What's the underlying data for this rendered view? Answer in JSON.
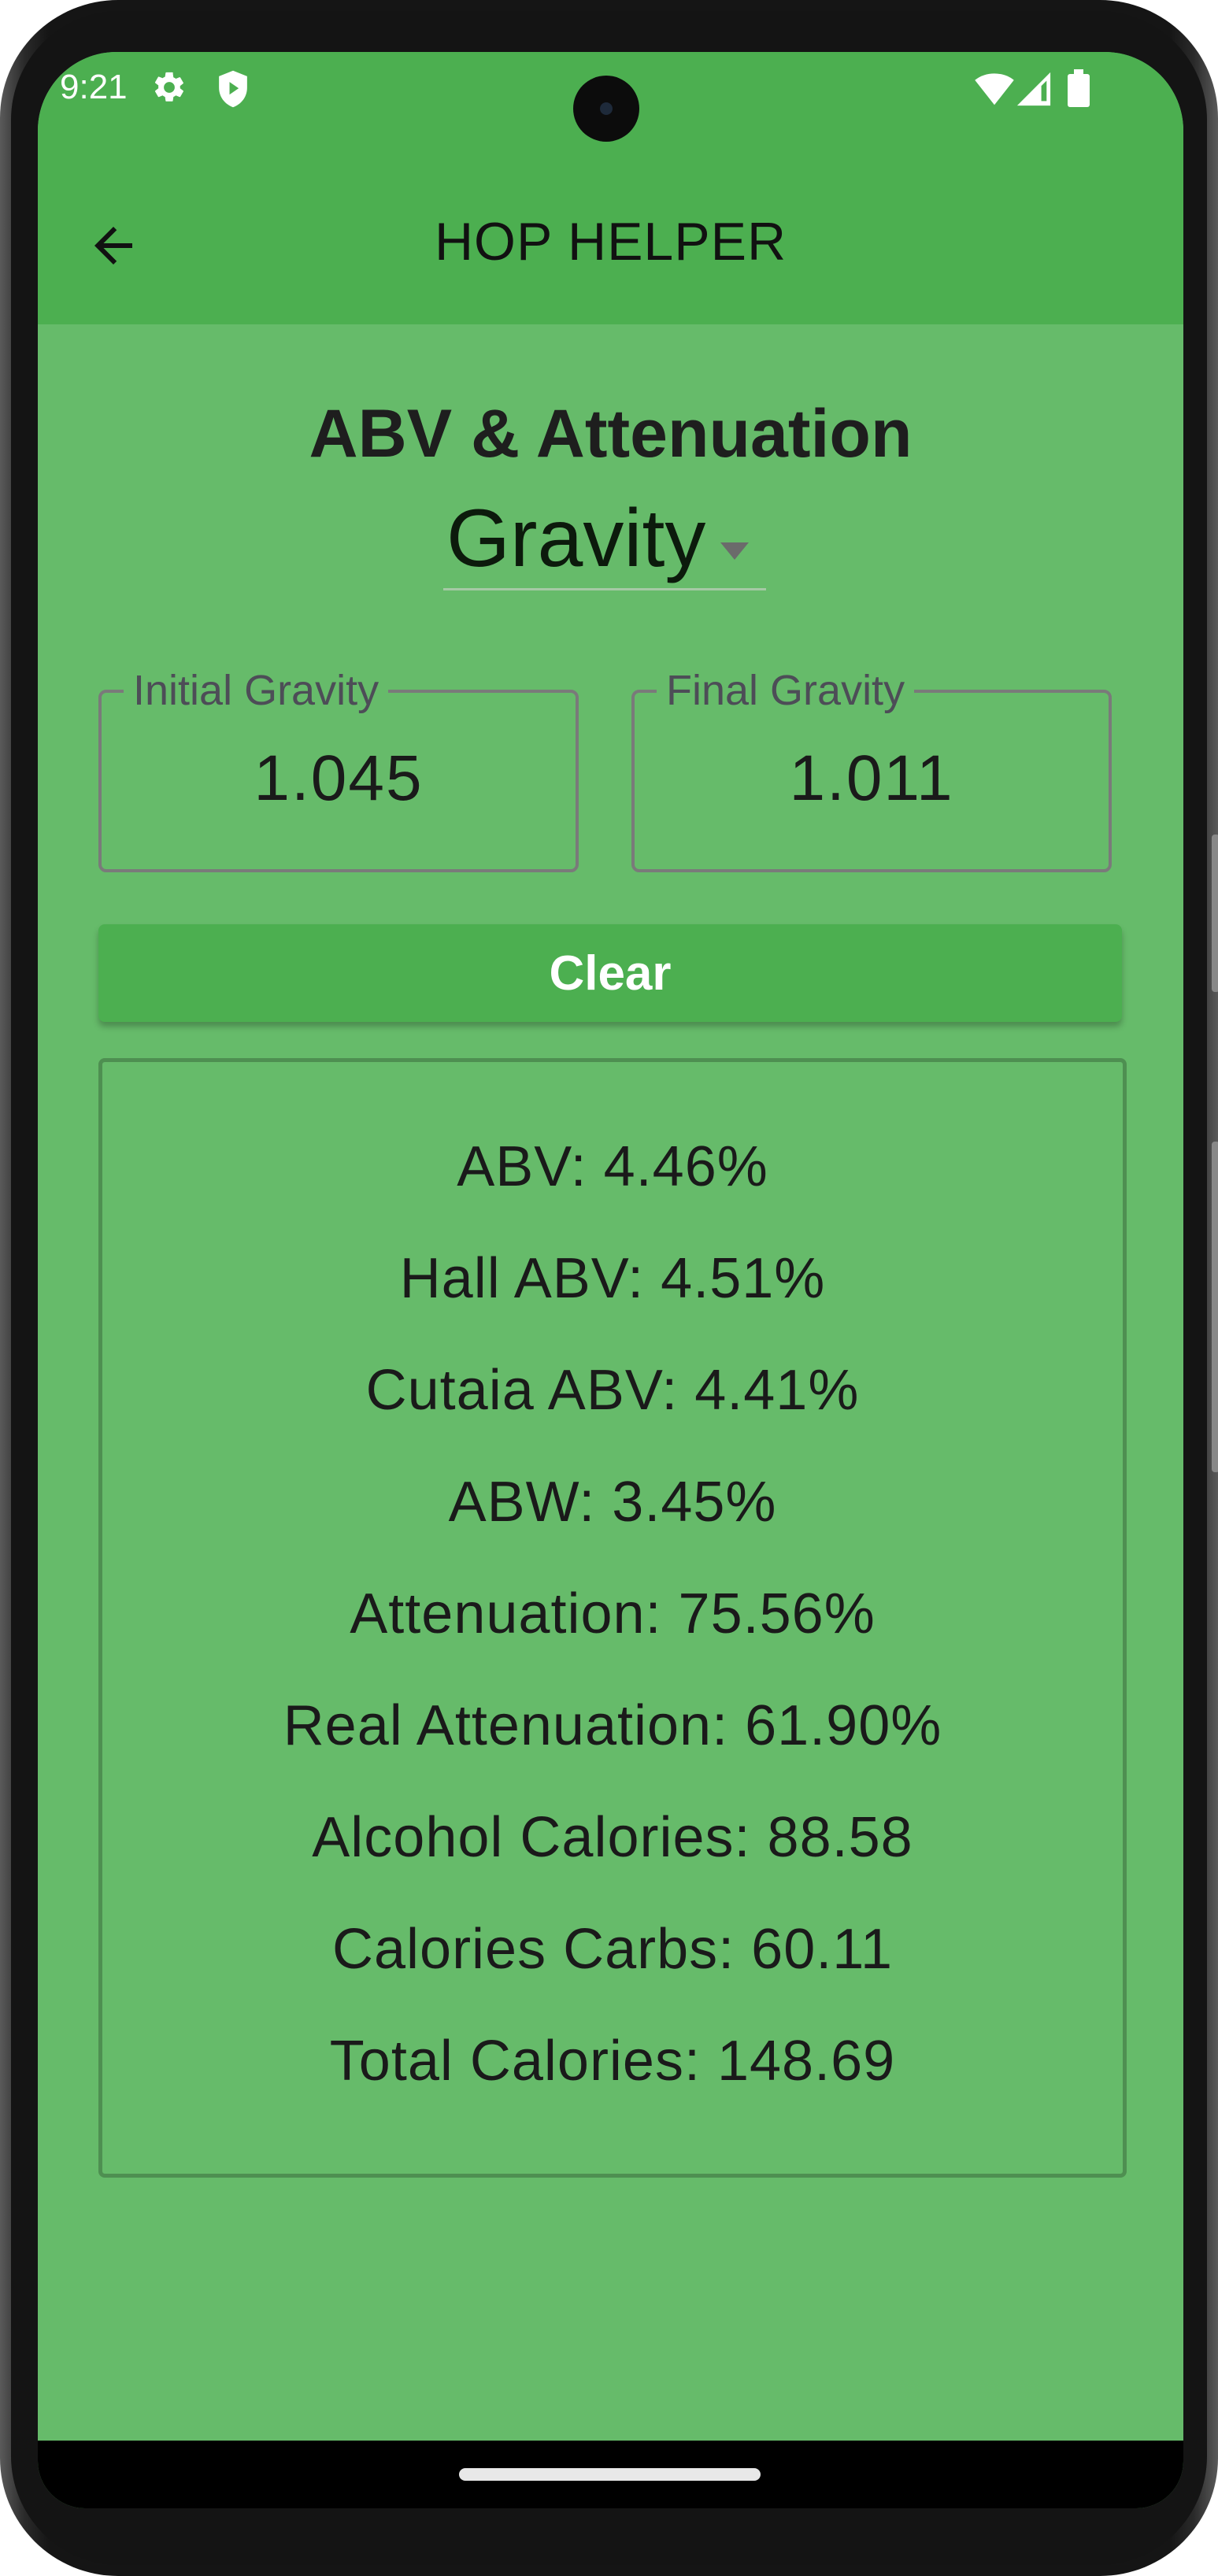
{
  "status_bar": {
    "time": "9:21",
    "left_icons": [
      "gear-icon",
      "shield-play-icon"
    ],
    "right_icons": [
      "wifi-icon",
      "cellular-signal-icon",
      "battery-icon"
    ]
  },
  "app_bar": {
    "title": "HOP HELPER",
    "back_icon": "arrow-left-icon"
  },
  "page": {
    "title": "ABV & Attenuation",
    "mode_dropdown": {
      "selected": "Gravity"
    },
    "inputs": {
      "initial": {
        "label": "Initial Gravity",
        "value": "1.045"
      },
      "final": {
        "label": "Final Gravity",
        "value": "1.011"
      }
    },
    "clear_label": "Clear",
    "results": [
      "ABV: 4.46%",
      "Hall ABV: 4.51%",
      "Cutaia ABV: 4.41%",
      "ABW: 3.45%",
      "Attenuation: 75.56%",
      "Real Attenuation: 61.90%",
      "Alcohol Calories: 88.58",
      "Calories Carbs: 60.11",
      "Total Calories: 148.69"
    ]
  },
  "colors": {
    "primary": "#4caf50",
    "background": "#66bb6a",
    "results_border": "#4e8f51",
    "text": "#1a1a1a"
  }
}
